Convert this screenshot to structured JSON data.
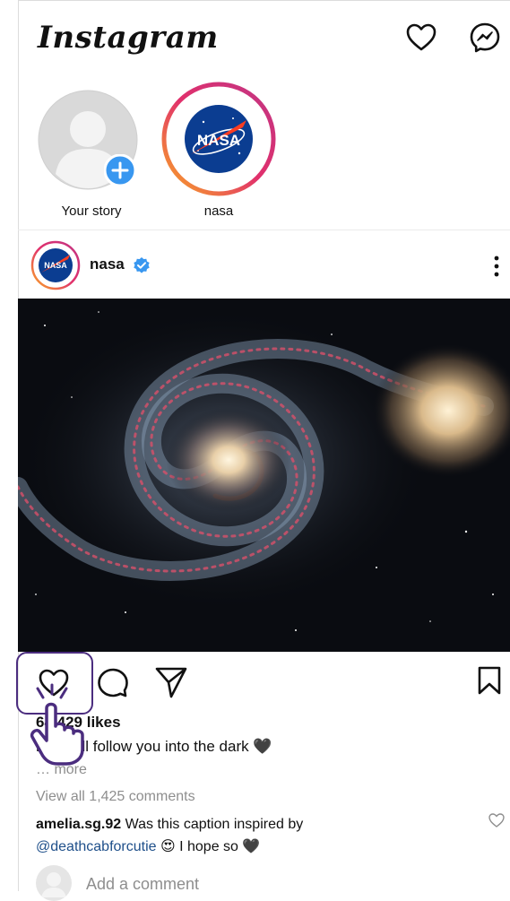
{
  "header": {
    "logo_text": "Instagram",
    "icons": [
      "heart-icon",
      "messenger-icon"
    ]
  },
  "stories": [
    {
      "label": "Your story",
      "add_badge": "+"
    },
    {
      "label": "nasa",
      "avatar_text": "NASA"
    }
  ],
  "post": {
    "username": "nasa",
    "verified": true,
    "avatar_text": "NASA",
    "likes": "64,429 likes",
    "caption_user": "nasa",
    "caption_text": "I'll follow you into the dark 🖤",
    "more_label": "… more",
    "view_comments": "View all 1,425 comments",
    "comment": {
      "user": "amelia.sg.92",
      "text_before": " Was this caption inspired by",
      "mention": "@deathcabforcutie",
      "text_after": " 😍 I hope so 🖤"
    },
    "add_comment_placeholder": "Add a comment"
  },
  "colors": {
    "story_ring_start": "#f9a825",
    "story_ring_mid": "#e1306c",
    "story_ring_end": "#c13584",
    "verified_blue": "#3897f0",
    "highlight_purple": "#4b2d7f"
  }
}
